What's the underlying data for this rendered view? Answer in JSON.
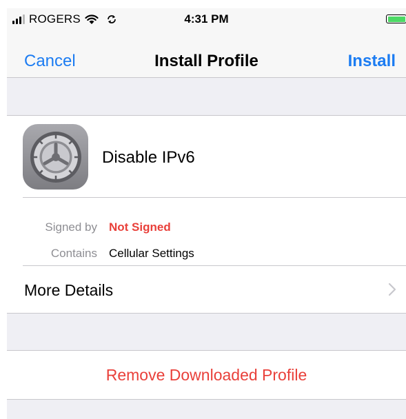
{
  "status_bar": {
    "carrier": "ROGERS",
    "time": "4:31 PM",
    "icons": [
      "signal-icon",
      "wifi-icon",
      "sync-icon",
      "battery-icon"
    ]
  },
  "nav": {
    "cancel": "Cancel",
    "title": "Install Profile",
    "install": "Install"
  },
  "profile": {
    "name": "Disable IPv6",
    "icon": "settings-gear-icon",
    "signed_by_label": "Signed by",
    "signed_by_value": "Not Signed",
    "contains_label": "Contains",
    "contains_value": "Cellular Settings",
    "more_details": "More Details"
  },
  "actions": {
    "remove": "Remove Downloaded Profile"
  },
  "colors": {
    "accent": "#1c7cf2",
    "destructive": "#e9403a",
    "background": "#efeff4"
  }
}
